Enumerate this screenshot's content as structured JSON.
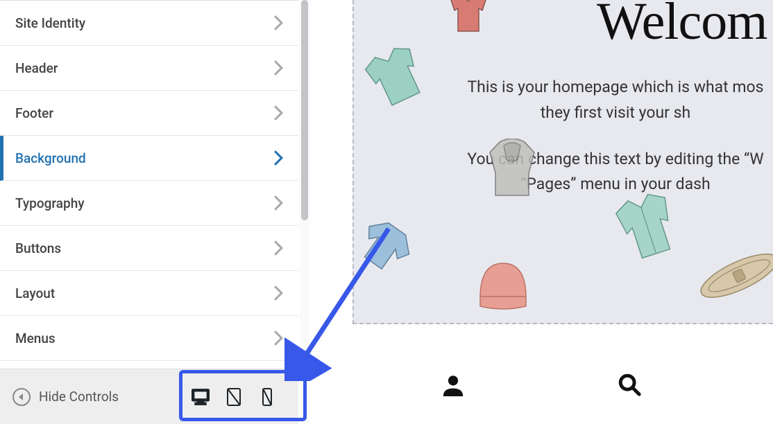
{
  "sidebar": {
    "items": [
      {
        "label": "Site Identity",
        "active": false
      },
      {
        "label": "Header",
        "active": false
      },
      {
        "label": "Footer",
        "active": false
      },
      {
        "label": "Background",
        "active": true
      },
      {
        "label": "Typography",
        "active": false
      },
      {
        "label": "Buttons",
        "active": false
      },
      {
        "label": "Layout",
        "active": false
      },
      {
        "label": "Menus",
        "active": false
      }
    ],
    "hide_controls_label": "Hide Controls"
  },
  "preview": {
    "hero_title": "Welcom",
    "hero_p1": "This is your homepage which is what mos",
    "hero_p2": "they first visit your sh",
    "hero_p3": "You can change this text by editing the “W",
    "hero_p4": "“Pages” menu in your dash"
  }
}
